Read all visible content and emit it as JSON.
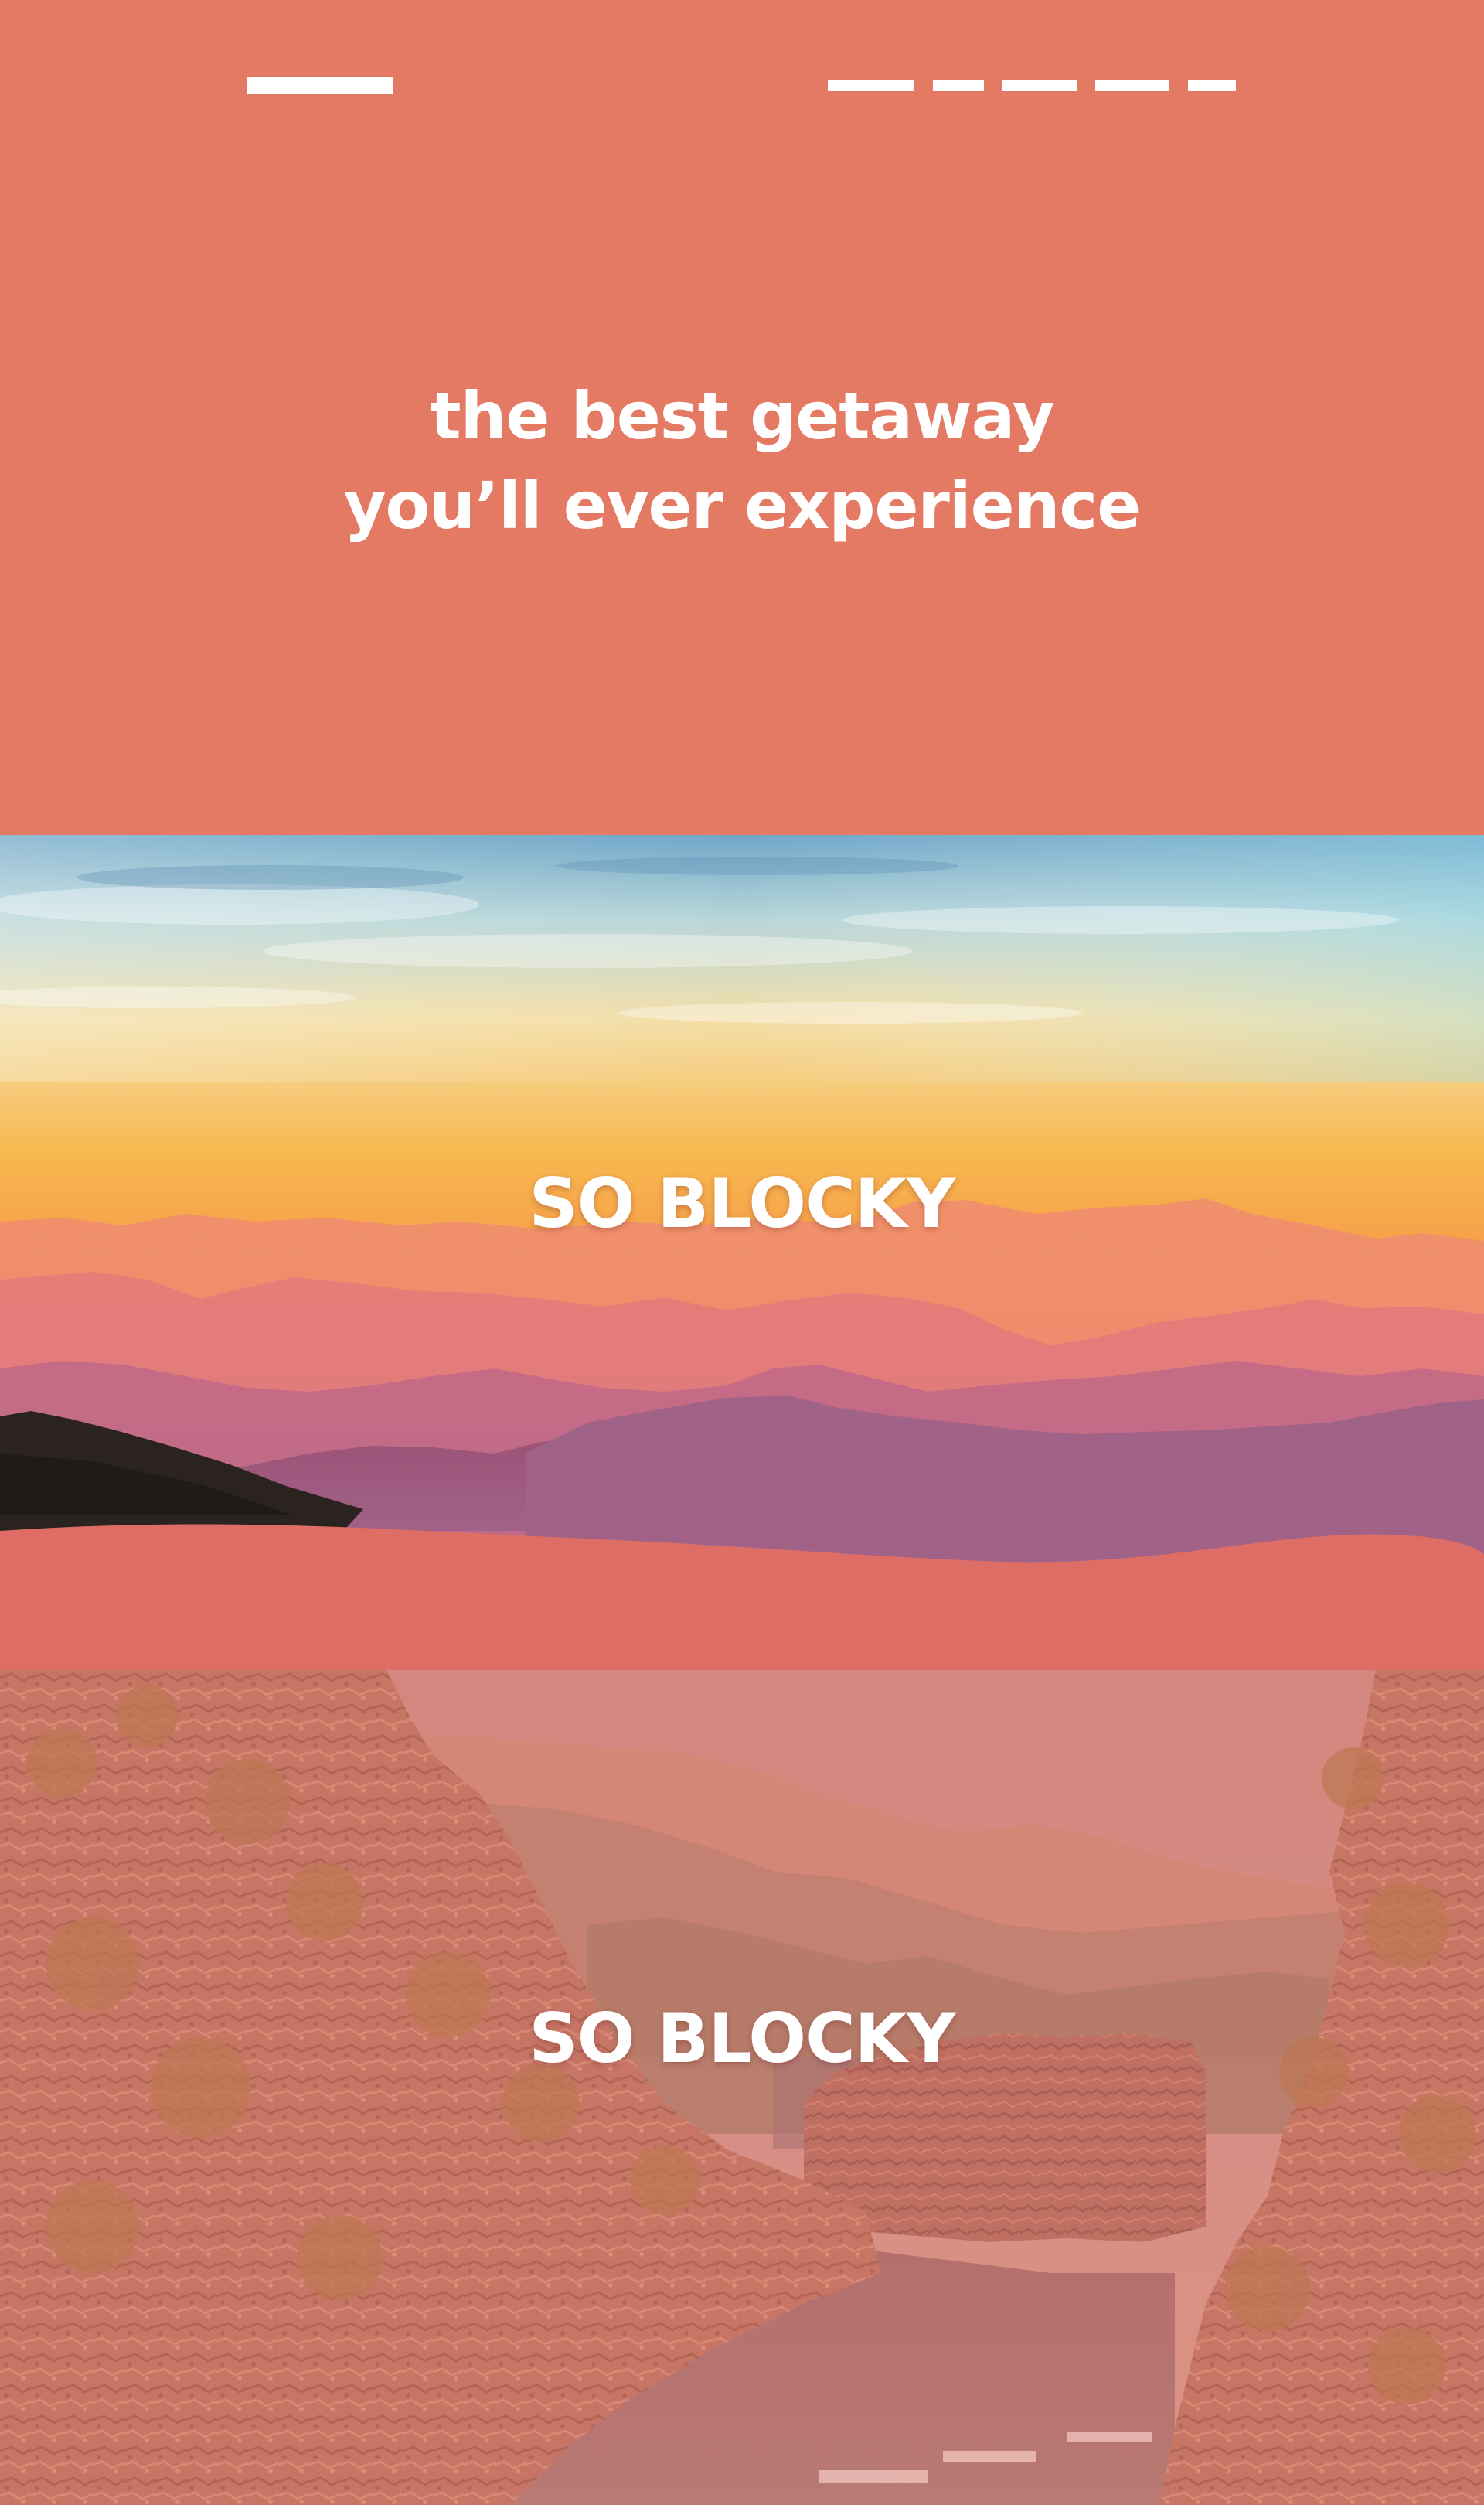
{
  "hero": {
    "title_line_1": "the best getaway",
    "title_line_2": "you’ll ever experience",
    "background_color": "#E57A64"
  },
  "nav": {
    "logo_icon": "logo-bar",
    "menu_item_count": 5
  },
  "sections": [
    {
      "title": "SO BLOCKY",
      "image": "mountain-sunset-landscape"
    },
    {
      "title": "SO BLOCKY",
      "image": "cliffs-lagoon-landscape"
    }
  ],
  "colors": {
    "accent": "#E57A64",
    "wave": "#DE6D66",
    "text": "#FFFFFF"
  }
}
